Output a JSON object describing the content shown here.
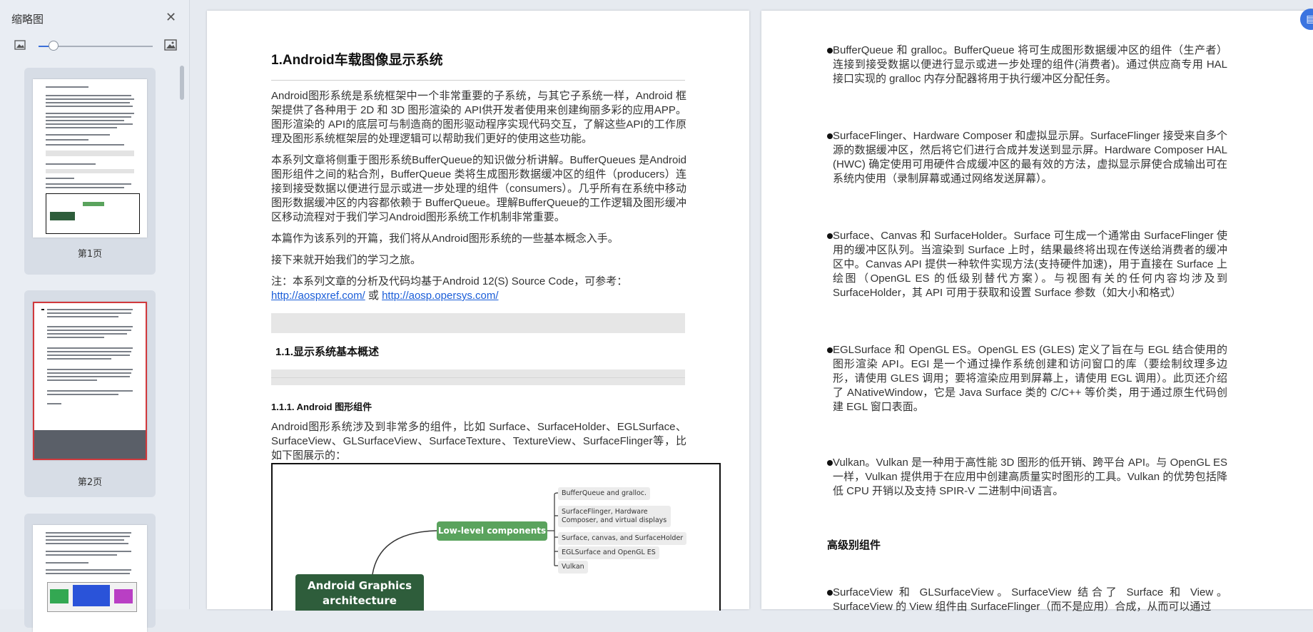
{
  "sidebar": {
    "title": "缩略图",
    "zoom_fraction": 0.13,
    "thumbnails": [
      {
        "label": "第1页",
        "selected": false
      },
      {
        "label": "第2页",
        "selected": true
      },
      {
        "label": "",
        "selected": false
      }
    ]
  },
  "page1": {
    "title": "1.Android车载图像显示系统",
    "p1": "Android图形系统是系统框架中一个非常重要的子系统，与其它子系统一样，Android 框架提供了各种用于 2D 和 3D 图形渲染的 API供开发者使用来创建绚丽多彩的应用APP。图形渲染的 API的底层可与制造商的图形驱动程序实现代码交互，了解这些API的工作原理及图形系统框架层的处理逻辑可以帮助我们更好的使用这些功能。",
    "p2": "本系列文章将侧重于图形系统BufferQueue的知识做分析讲解。BufferQueues 是Android 图形组件之间的粘合剂，BufferQueue 类将生成图形数据缓冲区的组件（producers）连接到接受数据以便进行显示或进一步处理的组件（consumers）。几乎所有在系统中移动图形数据缓冲区的内容都依赖于 BufferQueue。理解BufferQueue的工作逻辑及图形缓冲区移动流程对于我们学习Android图形系统工作机制非常重要。",
    "p3": "本篇作为该系列的开篇，我们将从Android图形系统的一些基本概念入手。",
    "p4": "接下来就开始我们的学习之旅。",
    "note": "注：本系列文章的分析及代码均基于Android 12(S) Source Code，可参考：",
    "link1": "http://aospxref.com/",
    "or": "或",
    "link2": "http://aosp.opersys.com/",
    "h2": "1.1.显示系统基本概述",
    "h3": "1.1.1. Android 图形组件",
    "p5": "Android图形系统涉及到非常多的组件，比如 Surface、SurfaceHolder、EGLSurface、SurfaceView、GLSurfaceView、SurfaceTexture、TextureView、SurfaceFlinger等，比如下图展示的：",
    "diagram": {
      "root": "Android Graphics architecture",
      "low": "Low-level components",
      "leaves": [
        "BufferQueue and gralloc.",
        "SurfaceFlinger, Hardware Composer, and virtual displays",
        "Surface, canvas, and SurfaceHolder",
        "EGLSurface and OpenGL ES",
        "Vulkan"
      ]
    }
  },
  "page2": {
    "bullets": [
      "BufferQueue 和 gralloc。BufferQueue 将可生成图形数据缓冲区的组件（生产者）连接到接受数据以便进行显示或进一步处理的组件(消费者)。通过供应商专用 HAL 接口实现的 gralloc 内存分配器将用于执行缓冲区分配任务。",
      "SurfaceFlinger、Hardware Composer 和虚拟显示屏。SurfaceFlinger 接受来自多个源的数据缓冲区，然后将它们进行合成并发送到显示屏。Hardware Composer HAL (HWC) 确定使用可用硬件合成缓冲区的最有效的方法，虚拟显示屏使合成输出可在系统内使用（录制屏幕或通过网络发送屏幕）。",
      "Surface、Canvas 和 SurfaceHolder。Surface 可生成一个通常由 SurfaceFlinger 使用的缓冲区队列。当渲染到 Surface 上时，结果最终将出现在传送给消费者的缓冲区中。Canvas API 提供一种软件实现方法(支持硬件加速)，用于直接在 Surface 上绘图（OpenGL ES 的低级别替代方案）。与视图有关的任何内容均涉及到 SurfaceHolder，其 API 可用于获取和设置 Surface 参数（如大小和格式）",
      "EGLSurface 和 OpenGL ES。OpenGL ES (GLES) 定义了旨在与 EGL 结合使用的图形渲染 API。EGI 是一个通过操作系统创建和访问窗口的库（要绘制纹理多边形，请使用 GLES 调用；要将渲染应用到屏幕上，请使用 EGL 调用）。此页还介绍了 ANativeWindow，它是 Java Surface 类的 C/C++ 等价类，用于通过原生代码创建 EGL 窗口表面。",
      "Vulkan。Vulkan 是一种用于高性能 3D 图形的低开销、跨平台 API。与 OpenGL ES 一样，Vulkan 提供用于在应用中创建高质量实时图形的工具。Vulkan 的优势包括降低 CPU 开销以及支持 SPIR-V 二进制中间语言。"
    ],
    "heading": "高级别组件",
    "last_bullet": "SurfaceView 和 GLSurfaceView。SurfaceView 结合了 Surface 和 View。SurfaceView 的 View 组件由 SurfaceFlinger（而不是应用）合成，从而可以通过"
  }
}
